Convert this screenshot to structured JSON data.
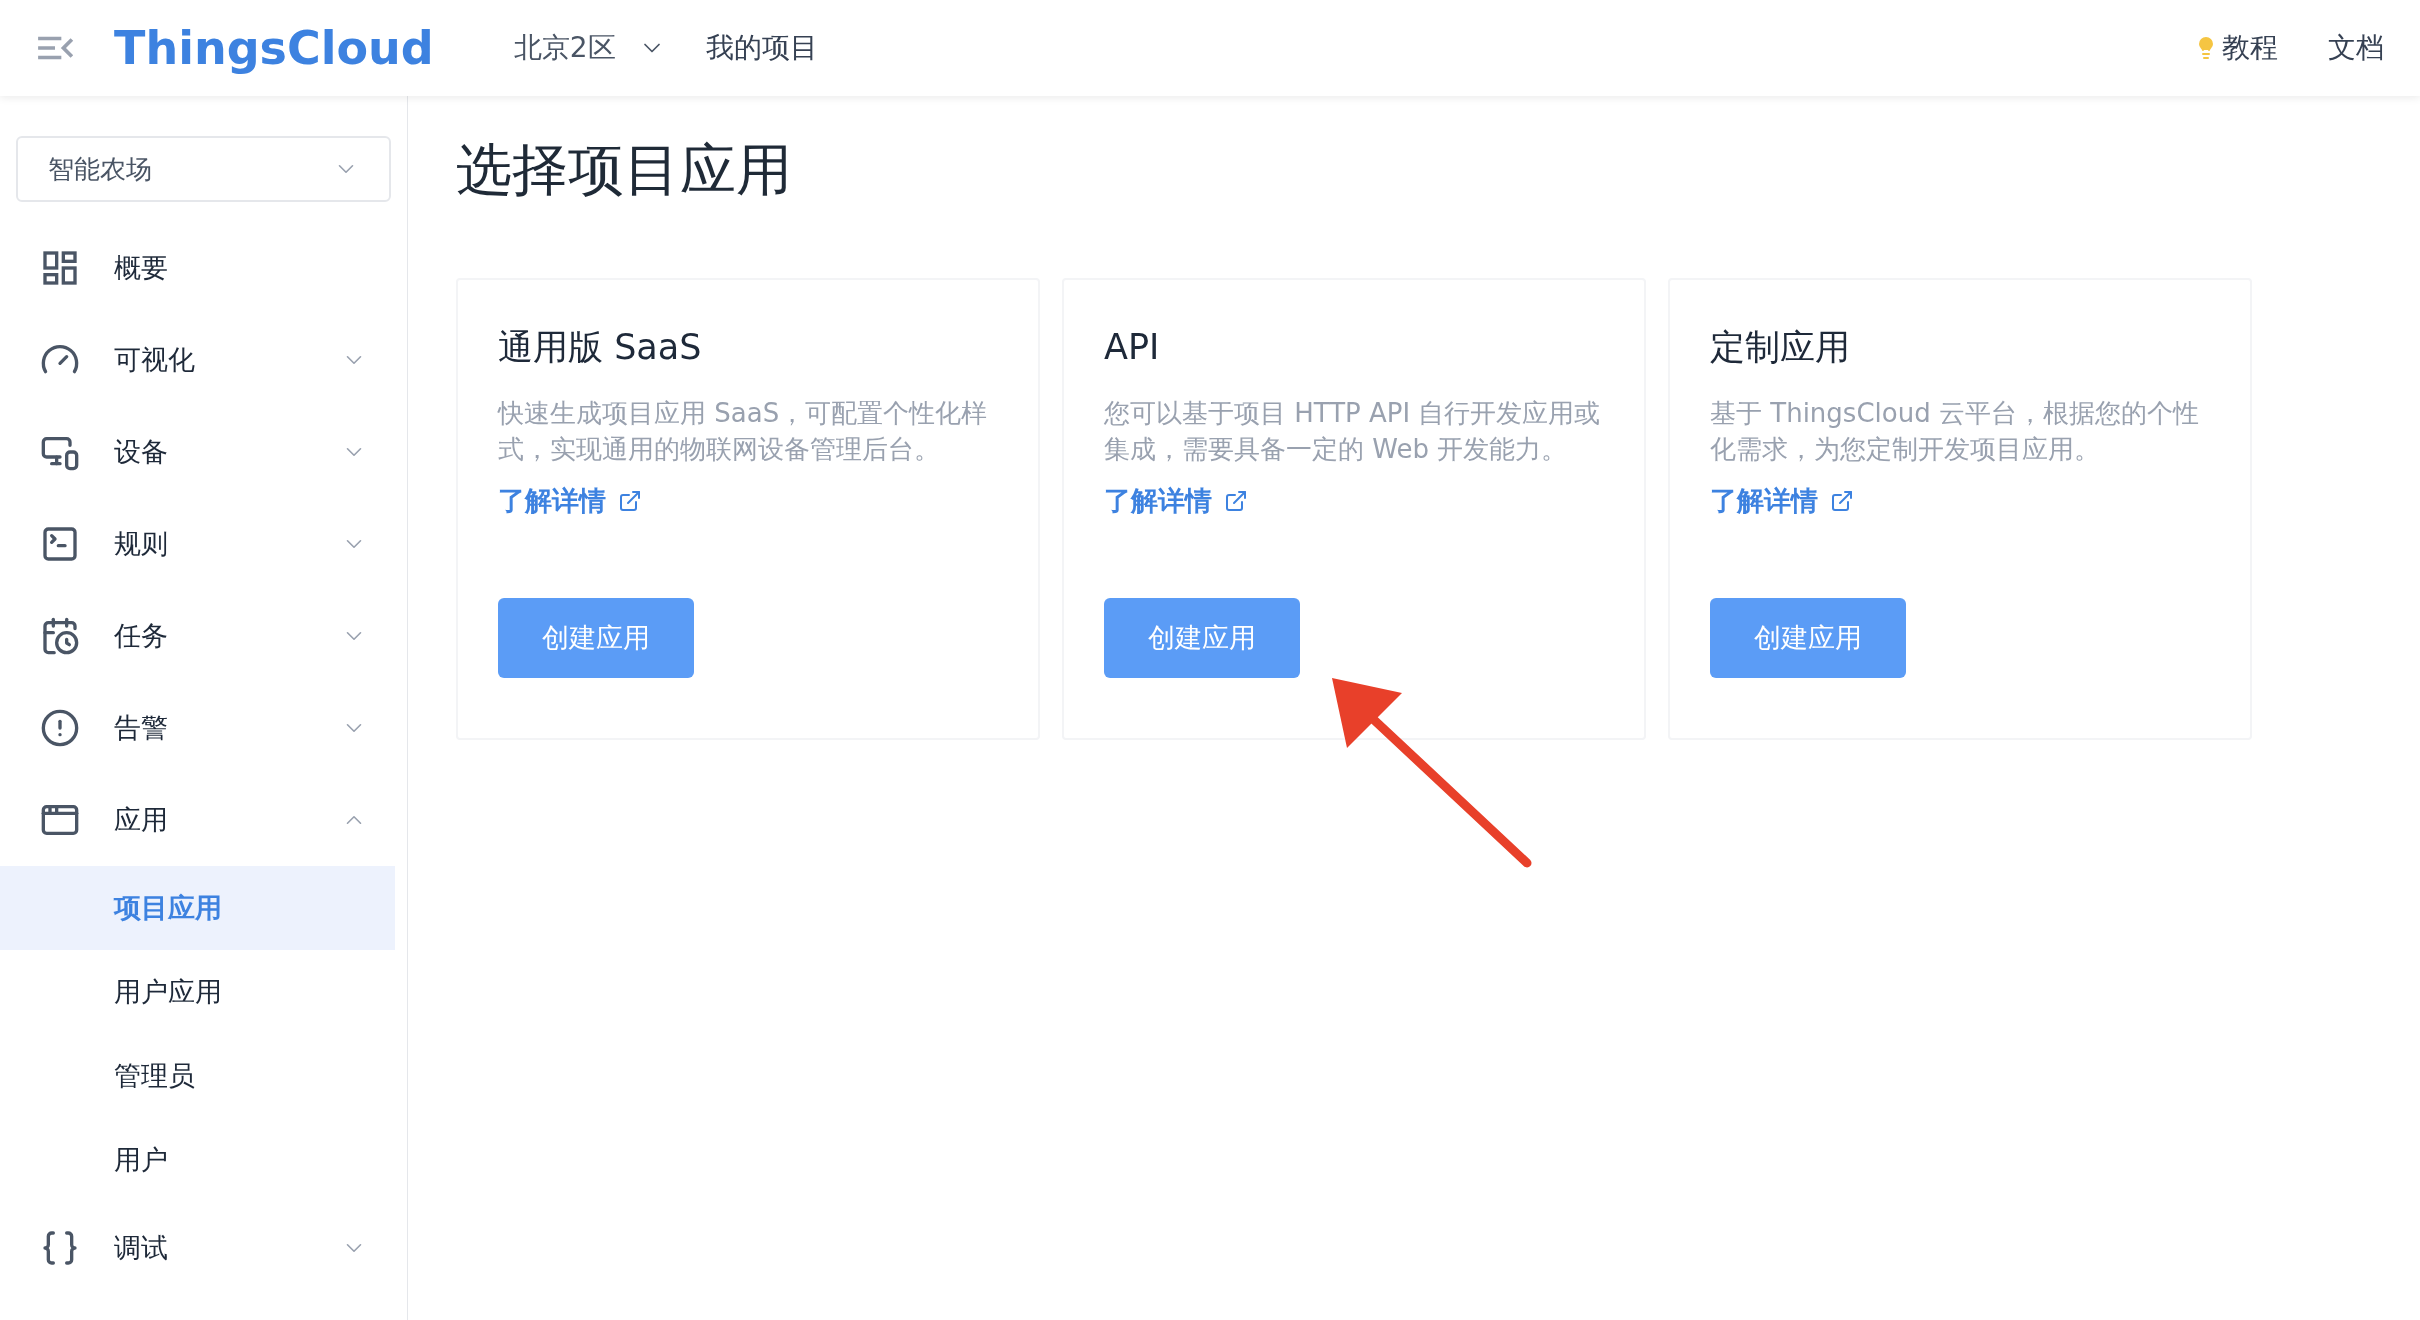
{
  "header": {
    "logo": "ThingsCloud",
    "region": "北京2区",
    "my_projects": "我的项目",
    "links": [
      "教程",
      "文档"
    ]
  },
  "sidebar": {
    "project_select": {
      "value": "智能农场"
    },
    "items": [
      {
        "label": "概要",
        "kind": "link"
      },
      {
        "label": "可视化",
        "kind": "group",
        "expanded": false
      },
      {
        "label": "设备",
        "kind": "group",
        "expanded": false
      },
      {
        "label": "规则",
        "kind": "group",
        "expanded": false
      },
      {
        "label": "任务",
        "kind": "group",
        "expanded": false
      },
      {
        "label": "告警",
        "kind": "group",
        "expanded": false
      },
      {
        "label": "应用",
        "kind": "group",
        "expanded": true,
        "children": [
          {
            "label": "项目应用",
            "selected": true
          },
          {
            "label": "用户应用",
            "selected": false
          },
          {
            "label": "管理员",
            "selected": false
          },
          {
            "label": "用户",
            "selected": false
          }
        ]
      },
      {
        "label": "调试",
        "kind": "group",
        "expanded": false
      }
    ]
  },
  "page": {
    "title": "选择项目应用",
    "cards": [
      {
        "title": "通用版 SaaS",
        "description": "快速生成项目应用 SaaS，可配置个性化样式，实现通用的物联网设备管理后台。",
        "link": "了解详情",
        "button": "创建应用"
      },
      {
        "title": "API",
        "description": "您可以基于项目 HTTP API 自行开发应用或集成，需要具备一定的 Web 开发能力。",
        "link": "了解详情",
        "button": "创建应用"
      },
      {
        "title": "定制应用",
        "description": "基于 ThingsCloud 云平台，根据您的个性化需求，为您定制开发项目应用。",
        "link": "了解详情",
        "button": "创建应用"
      }
    ]
  }
}
